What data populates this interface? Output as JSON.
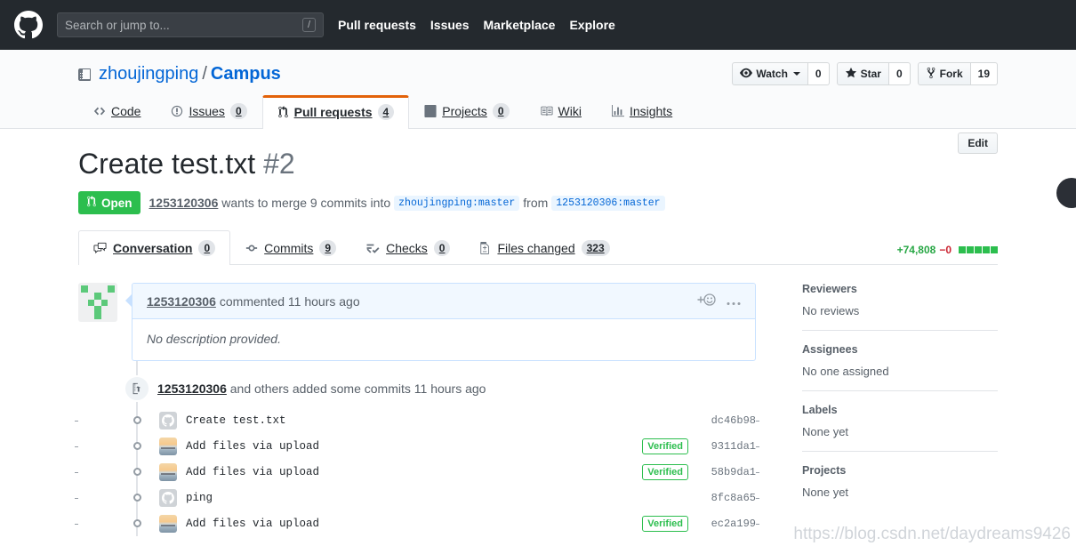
{
  "topbar": {
    "logo_icon": "github-mark-icon",
    "search": {
      "placeholder": "Search or jump to...",
      "value": "",
      "shortcut": "/"
    },
    "nav": [
      {
        "label": "Pull requests",
        "name": "pull-requests"
      },
      {
        "label": "Issues",
        "name": "issues"
      },
      {
        "label": "Marketplace",
        "name": "marketplace"
      },
      {
        "label": "Explore",
        "name": "explore"
      }
    ]
  },
  "repo": {
    "icon": "repo-icon",
    "owner": "zhoujingping",
    "separator": "/",
    "name": "Campus",
    "actions": [
      {
        "label": "Watch",
        "count": "0",
        "icon": "eye-icon",
        "has_caret": true
      },
      {
        "label": "Star",
        "count": "0",
        "icon": "star-icon",
        "has_caret": false
      },
      {
        "label": "Fork",
        "count": "19",
        "icon": "fork-icon",
        "has_caret": false
      }
    ],
    "nav": [
      {
        "label": "Code",
        "count": "",
        "icon": "code-icon",
        "selected": false
      },
      {
        "label": "Issues",
        "count": "0",
        "icon": "issue-opened-icon",
        "selected": false
      },
      {
        "label": "Pull requests",
        "count": "4",
        "icon": "git-pull-request-icon",
        "selected": true
      },
      {
        "label": "Projects",
        "count": "0",
        "icon": "project-icon",
        "selected": false
      },
      {
        "label": "Wiki",
        "count": "",
        "icon": "book-icon",
        "selected": false
      },
      {
        "label": "Insights",
        "count": "",
        "icon": "graph-icon",
        "selected": false
      }
    ]
  },
  "pull_request": {
    "title": "Create test.txt",
    "number": "#2",
    "edit_label": "Edit",
    "state": "Open",
    "state_icon": "git-pull-request-icon",
    "state_color": "#2cbe4e",
    "author": "1253120306",
    "merge_text_1": "wants to merge 9 commits into",
    "base_ref": "zhoujingping:master",
    "merge_text_2": "from",
    "head_ref": "1253120306:master",
    "tabs": [
      {
        "label": "Conversation",
        "count": "0",
        "icon": "comment-discussion-icon",
        "selected": true
      },
      {
        "label": "Commits",
        "count": "9",
        "icon": "git-commit-icon",
        "selected": false
      },
      {
        "label": "Checks",
        "count": "0",
        "icon": "checklist-icon",
        "selected": false
      },
      {
        "label": "Files changed",
        "count": "323",
        "icon": "diff-icon",
        "selected": false
      }
    ],
    "diffstat": {
      "additions": "+74,808",
      "deletions": "−0",
      "blocks": 5,
      "block_color": "#2cbe4e"
    }
  },
  "conversation": {
    "comment": {
      "avatar_icon": "identicon-avatar",
      "author": "1253120306",
      "action": "commented",
      "timestamp": "11 hours ago",
      "reaction_icon": "add-reaction-icon",
      "menu_icon": "kebab-horizontal-icon",
      "body": "No description provided."
    },
    "timeline_event": {
      "icon": "repo-push-icon",
      "author": "1253120306",
      "text": "and others added some commits",
      "timestamp": "11 hours ago"
    },
    "commits": [
      {
        "avatar": "github-logo-avatar",
        "message": "Create test.txt",
        "verified": "",
        "sha": "dc46b98"
      },
      {
        "avatar": "beach-photo-avatar",
        "message": "Add files via upload",
        "verified": "Verified",
        "sha": "9311da1"
      },
      {
        "avatar": "beach-photo-avatar",
        "message": "Add files via upload",
        "verified": "Verified",
        "sha": "58b9da1"
      },
      {
        "avatar": "github-logo-avatar",
        "message": "ping",
        "verified": "",
        "sha": "8fc8a65"
      },
      {
        "avatar": "beach-photo-avatar",
        "message": "Add files via upload",
        "verified": "Verified",
        "sha": "ec2a199"
      }
    ]
  },
  "sidebar": [
    {
      "heading": "Reviewers",
      "value": "No reviews",
      "name": "reviewers"
    },
    {
      "heading": "Assignees",
      "value": "No one assigned",
      "name": "assignees"
    },
    {
      "heading": "Labels",
      "value": "None yet",
      "name": "labels"
    },
    {
      "heading": "Projects",
      "value": "None yet",
      "name": "projects"
    }
  ],
  "watermark": "https://blog.csdn.net/daydreams9426"
}
